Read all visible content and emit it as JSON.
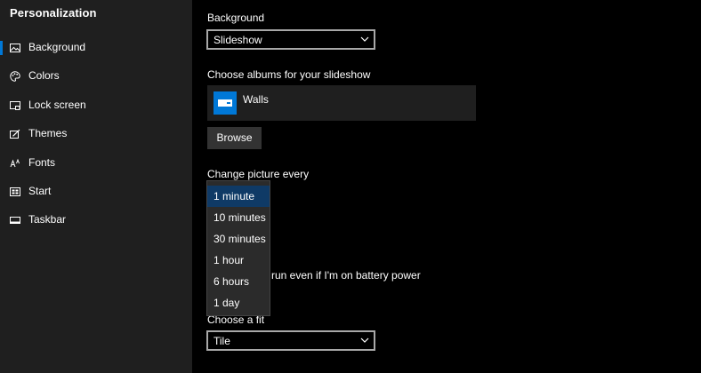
{
  "sidebar": {
    "title": "Personalization",
    "items": [
      {
        "label": "Background",
        "icon": "picture-icon",
        "selected": true
      },
      {
        "label": "Colors",
        "icon": "palette-icon",
        "selected": false
      },
      {
        "label": "Lock screen",
        "icon": "lock-screen-icon",
        "selected": false
      },
      {
        "label": "Themes",
        "icon": "themes-icon",
        "selected": false
      },
      {
        "label": "Fonts",
        "icon": "fonts-icon",
        "selected": false
      },
      {
        "label": "Start",
        "icon": "start-icon",
        "selected": false
      },
      {
        "label": "Taskbar",
        "icon": "taskbar-icon",
        "selected": false
      }
    ]
  },
  "main": {
    "background_label": "Background",
    "background_value": "Slideshow",
    "albums_label": "Choose albums for your slideshow",
    "album_name": "Walls",
    "browse_label": "Browse",
    "change_picture_label": "Change picture every",
    "change_picture_options": [
      "1 minute",
      "10 minutes",
      "30 minutes",
      "1 hour",
      "6 hours",
      "1 day"
    ],
    "change_picture_selected": "1 minute",
    "battery_label_visible": "run even if I'm on battery power",
    "fit_label": "Choose a fit",
    "fit_value": "Tile"
  },
  "colors": {
    "accent": "#0078d7",
    "sidebar_bg": "#1f1f1f",
    "content_bg": "#000000",
    "selected_option_bg": "#0f3a66"
  }
}
